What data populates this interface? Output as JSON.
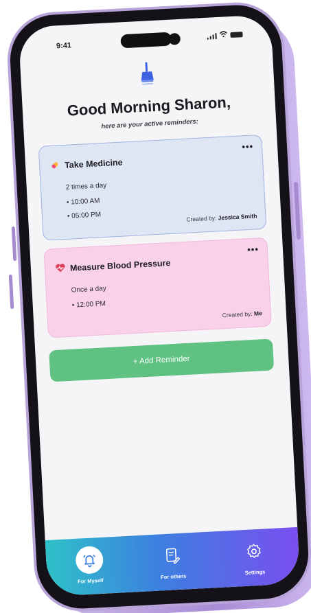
{
  "status_bar": {
    "time": "9:41"
  },
  "header": {
    "greeting": "Good Morning Sharon,",
    "subtitle": "here are your active reminders:"
  },
  "reminders": [
    {
      "title": "Take Medicine",
      "frequency": "2 times a day",
      "times": [
        "• 10:00 AM",
        "• 05:00 PM"
      ],
      "created_by_label": "Created by:",
      "created_by": "Jessica Smith",
      "menu": "•••",
      "icon": "pill-icon",
      "color": "#dfe6f3"
    },
    {
      "title": "Measure Blood Pressure",
      "frequency": "Once a day",
      "times": [
        "• 12:00 PM"
      ],
      "created_by_label": "Created by:",
      "created_by": "Me",
      "menu": "•••",
      "icon": "heart-monitor-icon",
      "color": "#f9d2ea"
    }
  ],
  "add_button": {
    "label": "+ Add Reminder",
    "color": "#5fc182"
  },
  "tabbar": {
    "tabs": [
      {
        "label": "For Myself",
        "icon": "bell-icon",
        "active": true
      },
      {
        "label": "For others",
        "icon": "clipboard-edit-icon",
        "active": false
      },
      {
        "label": "Settings",
        "icon": "gear-icon",
        "active": false
      }
    ]
  },
  "colors": {
    "accent_green": "#5fc182",
    "tabbar_gradient": [
      "#2ec1c8",
      "#3d7fe0",
      "#7a4ff0"
    ],
    "phone_frame": "#b8a4d9"
  }
}
